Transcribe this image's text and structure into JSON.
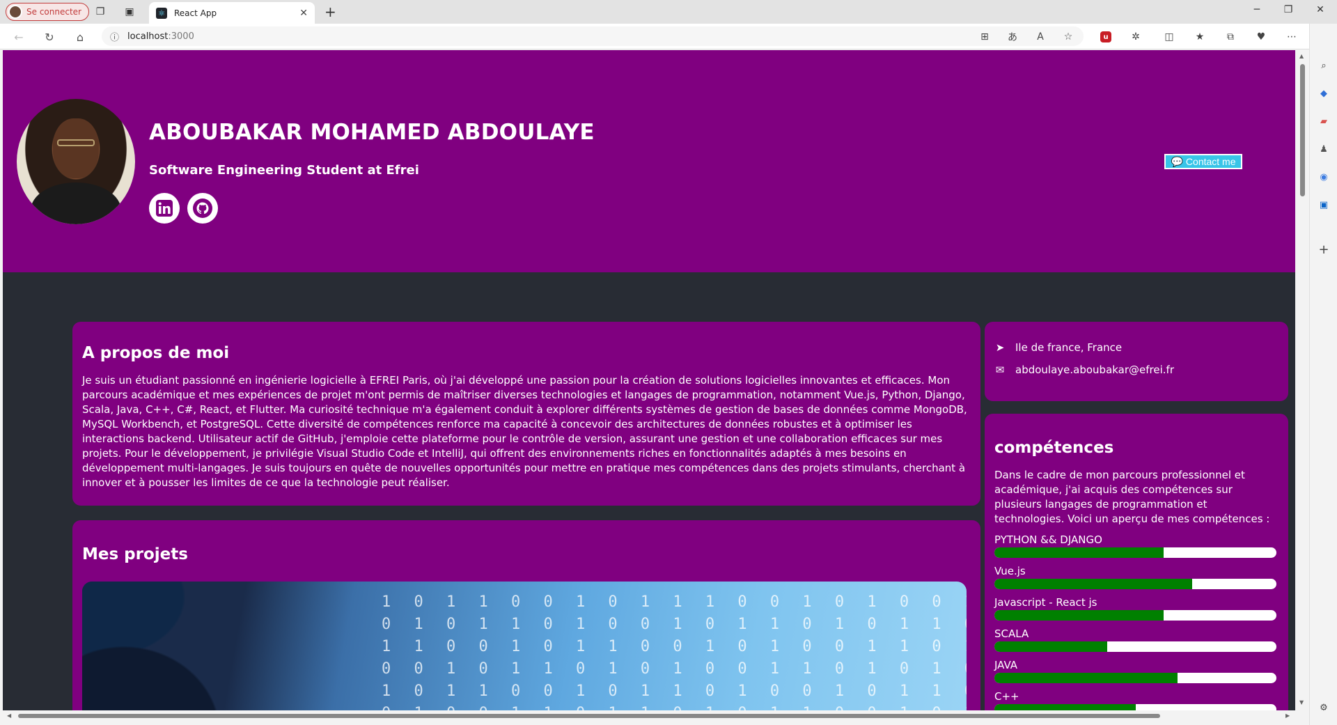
{
  "browser": {
    "profile_label": "Se connecter",
    "tab_title": "React App",
    "url_host": "localhost",
    "url_port": ":3000"
  },
  "hero": {
    "name": "ABOUBAKAR MOHAMED ABDOULAYE",
    "role": "Software Engineering Student at Efrei",
    "contact_label": "Contact me"
  },
  "about": {
    "title": "A propos de moi",
    "text": "Je suis un étudiant passionné en ingénierie logicielle à EFREI Paris, où j'ai développé une passion pour la création de solutions logicielles innovantes et efficaces. Mon parcours académique et mes expériences de projet m'ont permis de maîtriser diverses technologies et langages de programmation, notamment Vue.js, Python, Django, Scala, Java, C++, C#, React, et Flutter. Ma curiosité technique m'a également conduit à explorer différents systèmes de gestion de bases de données comme MongoDB, MySQL Workbench, et PostgreSQL. Cette diversité de compétences renforce ma capacité à concevoir des architectures de données robustes et à optimiser les interactions backend. Utilisateur actif de GitHub, j'emploie cette plateforme pour le contrôle de version, assurant une gestion et une collaboration efficaces sur mes projets. Pour le développement, je privilégie Visual Studio Code et IntelliJ, qui offrent des environnements riches en fonctionnalités adaptés à mes besoins en développement multi-langages. Je suis toujours en quête de nouvelles opportunités pour mettre en pratique mes compétences dans des projets stimulants, cherchant à innover et à pousser les limites de ce que la technologie peut réaliser."
  },
  "projects": {
    "title": "Mes projets"
  },
  "contact_info": {
    "location": "Ile de france, France",
    "email": "abdoulaye.aboubakar@efrei.fr"
  },
  "skills": {
    "title": "compétences",
    "intro": "Dans le cadre de mon parcours professionnel et académique, j'ai acquis des compétences sur plusieurs langages de programmation et technologies. Voici un aperçu de mes compétences :",
    "items": [
      {
        "label": "PYTHON && DJANGO",
        "level": 0.6
      },
      {
        "label": "Vue.js",
        "level": 0.7
      },
      {
        "label": "Javascript - React js",
        "level": 0.6
      },
      {
        "label": "SCALA",
        "level": 0.4
      },
      {
        "label": "JAVA",
        "level": 0.65
      },
      {
        "label": "C++",
        "level": 0.5
      }
    ]
  },
  "colors": {
    "accent": "#800080",
    "page_bg": "#282c34",
    "skill_fill": "#008000",
    "contact_button": "#38c5e8"
  }
}
